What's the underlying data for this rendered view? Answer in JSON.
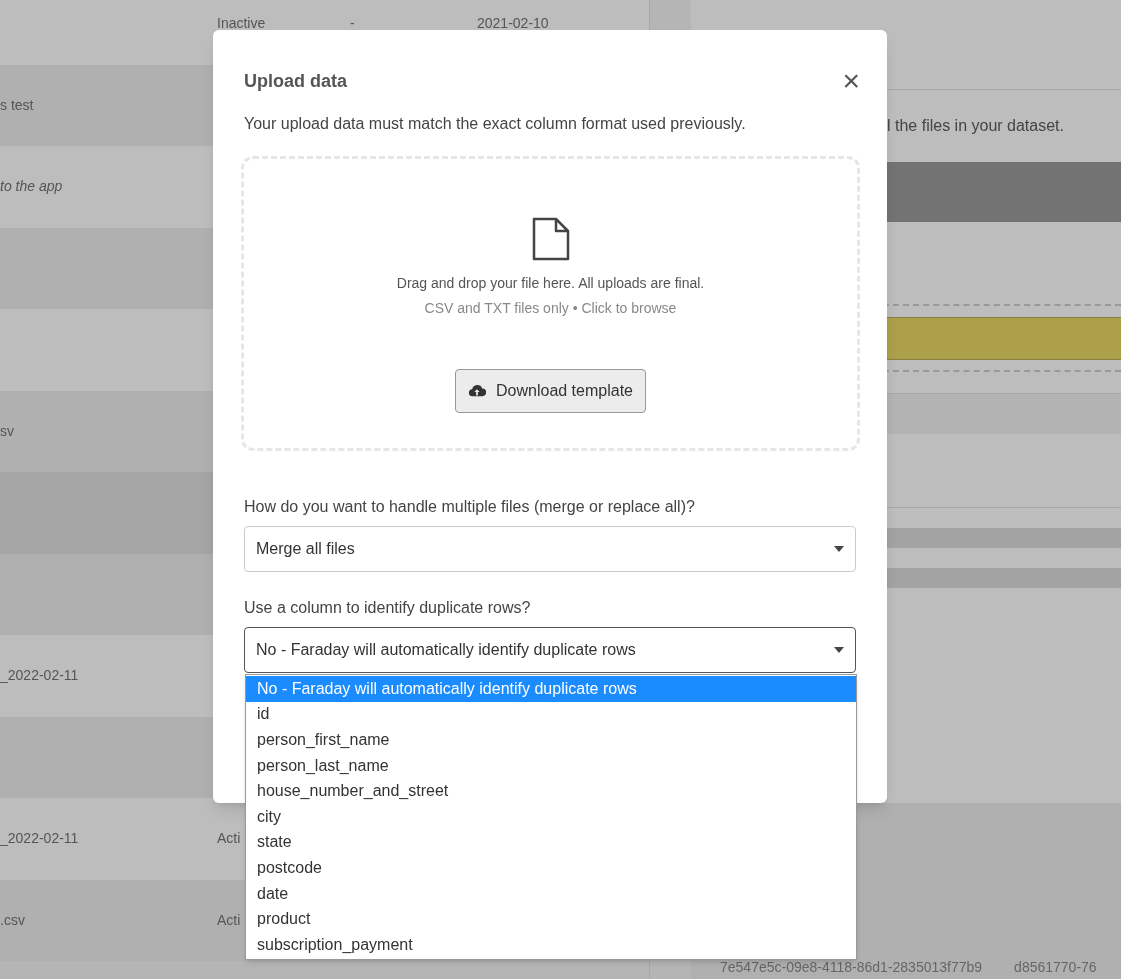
{
  "background_table": {
    "rows": [
      {
        "name": "",
        "status": "Inactive",
        "column_3": "-",
        "date": "2021-02-10",
        "italic": false
      },
      {
        "name": "s test",
        "status": "",
        "column_3": "",
        "date": "",
        "italic": false
      },
      {
        "name": "to the app",
        "status": "",
        "column_3": "",
        "date": "",
        "italic": true
      },
      {
        "name": "",
        "status": "",
        "column_3": "",
        "date": ""
      },
      {
        "name": "",
        "status": "",
        "column_3": "",
        "date": ""
      },
      {
        "name": "sv",
        "status": "",
        "column_3": "",
        "date": "",
        "italic": false
      },
      {
        "name": "",
        "status": "",
        "column_3": "",
        "date": ""
      },
      {
        "name": "",
        "status": "",
        "column_3": "",
        "date": ""
      },
      {
        "name": "_2022-02-11",
        "status": "",
        "column_3": "",
        "date": "",
        "italic": false
      },
      {
        "name": "",
        "status": "",
        "column_3": "",
        "date": ""
      },
      {
        "name": "_2022-02-11",
        "status": "Acti",
        "column_3": "",
        "date": "",
        "italic": false
      },
      {
        "name": ".csv",
        "status": "Acti",
        "column_3": "",
        "date": "",
        "italic": false
      }
    ]
  },
  "right_panel": {
    "description": "l the files in your dataset.",
    "id_values": [
      "7e547e5c-09e8-4118-86d1-2835013f77b9",
      "d8561770-76"
    ]
  },
  "modal": {
    "title": "Upload data",
    "close": "×",
    "subtitle": "Your upload data must match the exact column format used previously.",
    "dropzone": {
      "instruction": "Drag and drop your file here. All uploads are final.",
      "hint": "CSV and TXT files only • Click to browse",
      "button": "Download template"
    },
    "fields": [
      {
        "label": "How do you want to handle multiple files (merge or replace all)?",
        "value": "Merge all files",
        "expanded": false
      },
      {
        "label": "Use a column to identify duplicate rows?",
        "value": "No - Faraday will automatically identify duplicate rows",
        "expanded": true,
        "options": [
          {
            "label": "No - Faraday will automatically identify duplicate rows",
            "selected": true
          },
          {
            "label": "id",
            "selected": false
          },
          {
            "label": "person_first_name",
            "selected": false
          },
          {
            "label": "person_last_name",
            "selected": false
          },
          {
            "label": "house_number_and_street",
            "selected": false
          },
          {
            "label": "city",
            "selected": false
          },
          {
            "label": "state",
            "selected": false
          },
          {
            "label": "postcode",
            "selected": false
          },
          {
            "label": "date",
            "selected": false
          },
          {
            "label": "product",
            "selected": false
          },
          {
            "label": "subscription_payment",
            "selected": false
          }
        ]
      }
    ]
  }
}
